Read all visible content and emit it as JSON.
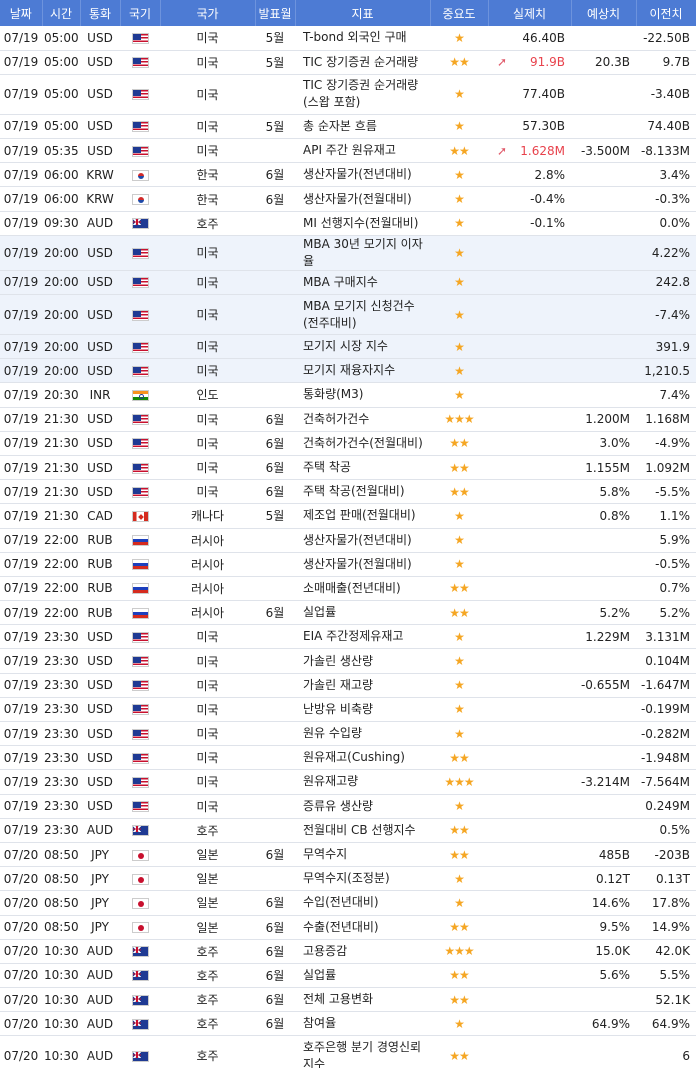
{
  "headers": {
    "date": "날짜",
    "time": "시간",
    "currency": "통화",
    "flag": "국기",
    "country": "국가",
    "period": "발표월",
    "indicator": "지표",
    "importance": "중요도",
    "actual": "실제치",
    "forecast": "예상치",
    "previous": "이전치"
  },
  "flag_icons": {
    "us": "us-flag-icon",
    "kr": "kr-flag-icon",
    "au": "au-flag-icon",
    "in": "in-flag-icon",
    "ca": "ca-flag-icon",
    "ru": "ru-flag-icon",
    "jp": "jp-flag-icon"
  },
  "colors": {
    "header_bg": "#4d7bd4",
    "star": "#f5a623",
    "actual_up": "#e8424c",
    "arrow": "#e05a6a",
    "highlight_row": "#eef3fb"
  },
  "rows": [
    {
      "date": "07/19",
      "time": "05:00",
      "cur": "USD",
      "flag": "us",
      "country": "미국",
      "period": "5월",
      "name": "T-bond 외국인 구매",
      "stars": "★",
      "arrow": "",
      "actual": "46.40B",
      "actual_class": "",
      "forecast": "",
      "previous": "-22.50B",
      "tall": false,
      "hl": false
    },
    {
      "date": "07/19",
      "time": "05:00",
      "cur": "USD",
      "flag": "us",
      "country": "미국",
      "period": "5월",
      "name": "TIC 장기증권 순거래량",
      "stars": "★★",
      "arrow": "➚",
      "actual": "91.9B",
      "actual_class": "up",
      "forecast": "20.3B",
      "previous": "9.7B",
      "tall": false,
      "hl": false
    },
    {
      "date": "07/19",
      "time": "05:00",
      "cur": "USD",
      "flag": "us",
      "country": "미국",
      "period": "",
      "name": "TIC 장기증권 순거래량(스왑 포함)",
      "stars": "★",
      "arrow": "",
      "actual": "77.40B",
      "actual_class": "",
      "forecast": "",
      "previous": "-3.40B",
      "tall": true,
      "hl": false
    },
    {
      "date": "07/19",
      "time": "05:00",
      "cur": "USD",
      "flag": "us",
      "country": "미국",
      "period": "5월",
      "name": "총 순자본 흐름",
      "stars": "★",
      "arrow": "",
      "actual": "57.30B",
      "actual_class": "",
      "forecast": "",
      "previous": "74.40B",
      "tall": false,
      "hl": false
    },
    {
      "date": "07/19",
      "time": "05:35",
      "cur": "USD",
      "flag": "us",
      "country": "미국",
      "period": "",
      "name": "API 주간 원유재고",
      "stars": "★★",
      "arrow": "➚",
      "actual": "1.628M",
      "actual_class": "up",
      "forecast": "-3.500M",
      "previous": "-8.133M",
      "tall": false,
      "hl": false
    },
    {
      "date": "07/19",
      "time": "06:00",
      "cur": "KRW",
      "flag": "kr",
      "country": "한국",
      "period": "6월",
      "name": "생산자물가(전년대비)",
      "stars": "★",
      "arrow": "",
      "actual": "2.8%",
      "actual_class": "",
      "forecast": "",
      "previous": "3.4%",
      "tall": false,
      "hl": false
    },
    {
      "date": "07/19",
      "time": "06:00",
      "cur": "KRW",
      "flag": "kr",
      "country": "한국",
      "period": "6월",
      "name": "생산자물가(전월대비)",
      "stars": "★",
      "arrow": "",
      "actual": "-0.4%",
      "actual_class": "",
      "forecast": "",
      "previous": "-0.3%",
      "tall": false,
      "hl": false
    },
    {
      "date": "07/19",
      "time": "09:30",
      "cur": "AUD",
      "flag": "au",
      "country": "호주",
      "period": "",
      "name": "MI 선행지수(전월대비)",
      "stars": "★",
      "arrow": "",
      "actual": "-0.1%",
      "actual_class": "",
      "forecast": "",
      "previous": "0.0%",
      "tall": false,
      "hl": false
    },
    {
      "date": "07/19",
      "time": "20:00",
      "cur": "USD",
      "flag": "us",
      "country": "미국",
      "period": "",
      "name": "MBA 30년 모기지 이자율",
      "stars": "★",
      "arrow": "",
      "actual": "",
      "actual_class": "",
      "forecast": "",
      "previous": "4.22%",
      "tall": false,
      "hl": true
    },
    {
      "date": "07/19",
      "time": "20:00",
      "cur": "USD",
      "flag": "us",
      "country": "미국",
      "period": "",
      "name": "MBA 구매지수",
      "stars": "★",
      "arrow": "",
      "actual": "",
      "actual_class": "",
      "forecast": "",
      "previous": "242.8",
      "tall": false,
      "hl": true
    },
    {
      "date": "07/19",
      "time": "20:00",
      "cur": "USD",
      "flag": "us",
      "country": "미국",
      "period": "",
      "name": "MBA 모기지 신청건수(전주대비)",
      "stars": "★",
      "arrow": "",
      "actual": "",
      "actual_class": "",
      "forecast": "",
      "previous": "-7.4%",
      "tall": true,
      "hl": true
    },
    {
      "date": "07/19",
      "time": "20:00",
      "cur": "USD",
      "flag": "us",
      "country": "미국",
      "period": "",
      "name": "모기지 시장 지수",
      "stars": "★",
      "arrow": "",
      "actual": "",
      "actual_class": "",
      "forecast": "",
      "previous": "391.9",
      "tall": false,
      "hl": true
    },
    {
      "date": "07/19",
      "time": "20:00",
      "cur": "USD",
      "flag": "us",
      "country": "미국",
      "period": "",
      "name": "모기지 재융자지수",
      "stars": "★",
      "arrow": "",
      "actual": "",
      "actual_class": "",
      "forecast": "",
      "previous": "1,210.5",
      "tall": false,
      "hl": true
    },
    {
      "date": "07/19",
      "time": "20:30",
      "cur": "INR",
      "flag": "in",
      "country": "인도",
      "period": "",
      "name": "통화량(M3)",
      "stars": "★",
      "arrow": "",
      "actual": "",
      "actual_class": "",
      "forecast": "",
      "previous": "7.4%",
      "tall": false,
      "hl": false
    },
    {
      "date": "07/19",
      "time": "21:30",
      "cur": "USD",
      "flag": "us",
      "country": "미국",
      "period": "6월",
      "name": "건축허가건수",
      "stars": "★★★",
      "arrow": "",
      "actual": "",
      "actual_class": "",
      "forecast": "1.200M",
      "previous": "1.168M",
      "tall": false,
      "hl": false
    },
    {
      "date": "07/19",
      "time": "21:30",
      "cur": "USD",
      "flag": "us",
      "country": "미국",
      "period": "6월",
      "name": "건축허가건수(전월대비)",
      "stars": "★★",
      "arrow": "",
      "actual": "",
      "actual_class": "",
      "forecast": "3.0%",
      "previous": "-4.9%",
      "tall": false,
      "hl": false
    },
    {
      "date": "07/19",
      "time": "21:30",
      "cur": "USD",
      "flag": "us",
      "country": "미국",
      "period": "6월",
      "name": "주택 착공",
      "stars": "★★",
      "arrow": "",
      "actual": "",
      "actual_class": "",
      "forecast": "1.155M",
      "previous": "1.092M",
      "tall": false,
      "hl": false
    },
    {
      "date": "07/19",
      "time": "21:30",
      "cur": "USD",
      "flag": "us",
      "country": "미국",
      "period": "6월",
      "name": "주택 착공(전월대비)",
      "stars": "★★",
      "arrow": "",
      "actual": "",
      "actual_class": "",
      "forecast": "5.8%",
      "previous": "-5.5%",
      "tall": false,
      "hl": false
    },
    {
      "date": "07/19",
      "time": "21:30",
      "cur": "CAD",
      "flag": "ca",
      "country": "캐나다",
      "period": "5월",
      "name": "제조업 판매(전월대비)",
      "stars": "★",
      "arrow": "",
      "actual": "",
      "actual_class": "",
      "forecast": "0.8%",
      "previous": "1.1%",
      "tall": false,
      "hl": false
    },
    {
      "date": "07/19",
      "time": "22:00",
      "cur": "RUB",
      "flag": "ru",
      "country": "러시아",
      "period": "",
      "name": "생산자물가(전년대비)",
      "stars": "★",
      "arrow": "",
      "actual": "",
      "actual_class": "",
      "forecast": "",
      "previous": "5.9%",
      "tall": false,
      "hl": false
    },
    {
      "date": "07/19",
      "time": "22:00",
      "cur": "RUB",
      "flag": "ru",
      "country": "러시아",
      "period": "",
      "name": "생산자물가(전월대비)",
      "stars": "★",
      "arrow": "",
      "actual": "",
      "actual_class": "",
      "forecast": "",
      "previous": "-0.5%",
      "tall": false,
      "hl": false
    },
    {
      "date": "07/19",
      "time": "22:00",
      "cur": "RUB",
      "flag": "ru",
      "country": "러시아",
      "period": "",
      "name": "소매매출(전년대비)",
      "stars": "★★",
      "arrow": "",
      "actual": "",
      "actual_class": "",
      "forecast": "",
      "previous": "0.7%",
      "tall": false,
      "hl": false
    },
    {
      "date": "07/19",
      "time": "22:00",
      "cur": "RUB",
      "flag": "ru",
      "country": "러시아",
      "period": "6월",
      "name": "실업률",
      "stars": "★★",
      "arrow": "",
      "actual": "",
      "actual_class": "",
      "forecast": "5.2%",
      "previous": "5.2%",
      "tall": false,
      "hl": false
    },
    {
      "date": "07/19",
      "time": "23:30",
      "cur": "USD",
      "flag": "us",
      "country": "미국",
      "period": "",
      "name": "EIA 주간정제유재고",
      "stars": "★",
      "arrow": "",
      "actual": "",
      "actual_class": "",
      "forecast": "1.229M",
      "previous": "3.131M",
      "tall": false,
      "hl": false
    },
    {
      "date": "07/19",
      "time": "23:30",
      "cur": "USD",
      "flag": "us",
      "country": "미국",
      "period": "",
      "name": "가솔린 생산량",
      "stars": "★",
      "arrow": "",
      "actual": "",
      "actual_class": "",
      "forecast": "",
      "previous": "0.104M",
      "tall": false,
      "hl": false
    },
    {
      "date": "07/19",
      "time": "23:30",
      "cur": "USD",
      "flag": "us",
      "country": "미국",
      "period": "",
      "name": "가솔린 재고량",
      "stars": "★",
      "arrow": "",
      "actual": "",
      "actual_class": "",
      "forecast": "-0.655M",
      "previous": "-1.647M",
      "tall": false,
      "hl": false
    },
    {
      "date": "07/19",
      "time": "23:30",
      "cur": "USD",
      "flag": "us",
      "country": "미국",
      "period": "",
      "name": "난방유 비축량",
      "stars": "★",
      "arrow": "",
      "actual": "",
      "actual_class": "",
      "forecast": "",
      "previous": "-0.199M",
      "tall": false,
      "hl": false
    },
    {
      "date": "07/19",
      "time": "23:30",
      "cur": "USD",
      "flag": "us",
      "country": "미국",
      "period": "",
      "name": "원유 수입량",
      "stars": "★",
      "arrow": "",
      "actual": "",
      "actual_class": "",
      "forecast": "",
      "previous": "-0.282M",
      "tall": false,
      "hl": false
    },
    {
      "date": "07/19",
      "time": "23:30",
      "cur": "USD",
      "flag": "us",
      "country": "미국",
      "period": "",
      "name": "원유재고(Cushing)",
      "stars": "★★",
      "arrow": "",
      "actual": "",
      "actual_class": "",
      "forecast": "",
      "previous": "-1.948M",
      "tall": false,
      "hl": false
    },
    {
      "date": "07/19",
      "time": "23:30",
      "cur": "USD",
      "flag": "us",
      "country": "미국",
      "period": "",
      "name": "원유재고량",
      "stars": "★★★",
      "arrow": "",
      "actual": "",
      "actual_class": "",
      "forecast": "-3.214M",
      "previous": "-7.564M",
      "tall": false,
      "hl": false
    },
    {
      "date": "07/19",
      "time": "23:30",
      "cur": "USD",
      "flag": "us",
      "country": "미국",
      "period": "",
      "name": "증류유 생산량",
      "stars": "★",
      "arrow": "",
      "actual": "",
      "actual_class": "",
      "forecast": "",
      "previous": "0.249M",
      "tall": false,
      "hl": false
    },
    {
      "date": "07/19",
      "time": "23:30",
      "cur": "AUD",
      "flag": "au",
      "country": "호주",
      "period": "",
      "name": "전월대비 CB 선행지수",
      "stars": "★★",
      "arrow": "",
      "actual": "",
      "actual_class": "",
      "forecast": "",
      "previous": "0.5%",
      "tall": false,
      "hl": false
    },
    {
      "date": "07/20",
      "time": "08:50",
      "cur": "JPY",
      "flag": "jp",
      "country": "일본",
      "period": "6월",
      "name": "무역수지",
      "stars": "★★",
      "arrow": "",
      "actual": "",
      "actual_class": "",
      "forecast": "485B",
      "previous": "-203B",
      "tall": false,
      "hl": false
    },
    {
      "date": "07/20",
      "time": "08:50",
      "cur": "JPY",
      "flag": "jp",
      "country": "일본",
      "period": "",
      "name": "무역수지(조정분)",
      "stars": "★",
      "arrow": "",
      "actual": "",
      "actual_class": "",
      "forecast": "0.12T",
      "previous": "0.13T",
      "tall": false,
      "hl": false
    },
    {
      "date": "07/20",
      "time": "08:50",
      "cur": "JPY",
      "flag": "jp",
      "country": "일본",
      "period": "6월",
      "name": "수입(전년대비)",
      "stars": "★",
      "arrow": "",
      "actual": "",
      "actual_class": "",
      "forecast": "14.6%",
      "previous": "17.8%",
      "tall": false,
      "hl": false
    },
    {
      "date": "07/20",
      "time": "08:50",
      "cur": "JPY",
      "flag": "jp",
      "country": "일본",
      "period": "6월",
      "name": "수출(전년대비)",
      "stars": "★★",
      "arrow": "",
      "actual": "",
      "actual_class": "",
      "forecast": "9.5%",
      "previous": "14.9%",
      "tall": false,
      "hl": false
    },
    {
      "date": "07/20",
      "time": "10:30",
      "cur": "AUD",
      "flag": "au",
      "country": "호주",
      "period": "6월",
      "name": "고용증감",
      "stars": "★★★",
      "arrow": "",
      "actual": "",
      "actual_class": "",
      "forecast": "15.0K",
      "previous": "42.0K",
      "tall": false,
      "hl": false
    },
    {
      "date": "07/20",
      "time": "10:30",
      "cur": "AUD",
      "flag": "au",
      "country": "호주",
      "period": "6월",
      "name": "실업률",
      "stars": "★★",
      "arrow": "",
      "actual": "",
      "actual_class": "",
      "forecast": "5.6%",
      "previous": "5.5%",
      "tall": false,
      "hl": false
    },
    {
      "date": "07/20",
      "time": "10:30",
      "cur": "AUD",
      "flag": "au",
      "country": "호주",
      "period": "6월",
      "name": "전체 고용변화",
      "stars": "★★",
      "arrow": "",
      "actual": "",
      "actual_class": "",
      "forecast": "",
      "previous": "52.1K",
      "tall": false,
      "hl": false
    },
    {
      "date": "07/20",
      "time": "10:30",
      "cur": "AUD",
      "flag": "au",
      "country": "호주",
      "period": "6월",
      "name": "참여율",
      "stars": "★",
      "arrow": "",
      "actual": "",
      "actual_class": "",
      "forecast": "64.9%",
      "previous": "64.9%",
      "tall": false,
      "hl": false
    },
    {
      "date": "07/20",
      "time": "10:30",
      "cur": "AUD",
      "flag": "au",
      "country": "호주",
      "period": "",
      "name": "호주은행 분기 경영신뢰지수",
      "stars": "★★",
      "arrow": "",
      "actual": "",
      "actual_class": "",
      "forecast": "",
      "previous": "6",
      "tall": true,
      "hl": false
    }
  ]
}
